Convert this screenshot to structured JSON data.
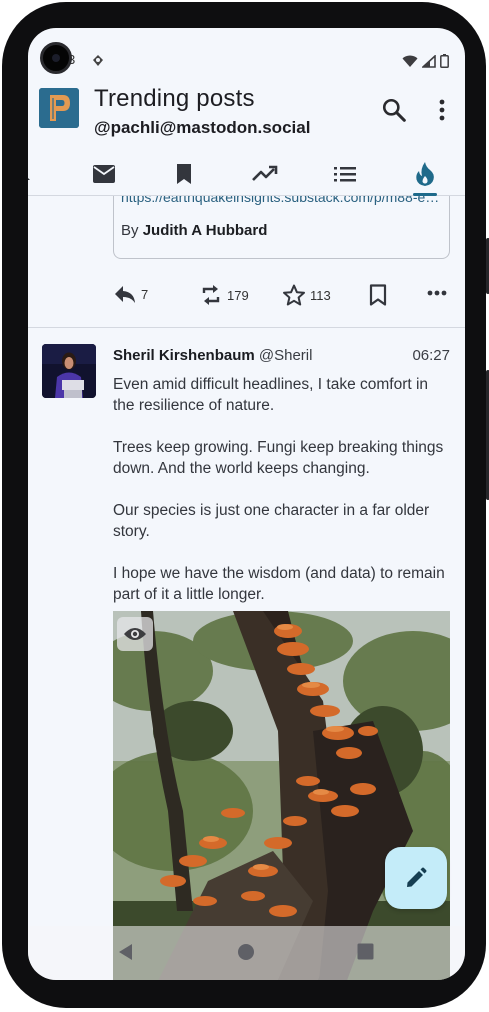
{
  "status_bar": {
    "time_fragment": "3",
    "icons": [
      "notification-icon",
      "wifi-icon",
      "signal-icon",
      "battery-icon"
    ]
  },
  "app_bar": {
    "title": "Trending posts",
    "account": "@pachli@mastodon.social",
    "logo_letter": "P",
    "actions": [
      "search-icon",
      "overflow-menu-icon"
    ]
  },
  "tabs": [
    {
      "name": "tab-notifications",
      "icon": "bell-icon",
      "selected": false
    },
    {
      "name": "tab-messages",
      "icon": "mail-icon",
      "selected": false
    },
    {
      "name": "tab-bookmarks",
      "icon": "bookmark-icon",
      "selected": false
    },
    {
      "name": "tab-trending",
      "icon": "trending-icon",
      "selected": false
    },
    {
      "name": "tab-lists",
      "icon": "list-icon",
      "selected": false
    },
    {
      "name": "tab-trending-posts",
      "icon": "flame-icon",
      "selected": true
    }
  ],
  "previous_post": {
    "link_url": "https://earthquakeinsights.substack.com/p/m88-ea...",
    "link_author_prefix": "By",
    "link_author": "Judith A Hubbard",
    "actions": {
      "replies": "7",
      "boosts": "179",
      "favourites": "113"
    }
  },
  "post": {
    "display_name": "Sheril Kirshenbaum",
    "handle": "@Sheril",
    "time": "06:27",
    "paragraphs": [
      "Even amid difficult headlines, I take comfort in the resilience of nature.",
      "Trees keep growing. Fungi keep breaking things down. And the world keeps changing.",
      "Our species is just one character in a far older story.",
      "I hope we have the wisdom (and data) to remain part of it a little longer."
    ]
  },
  "fab": {
    "icon": "pencil-icon"
  },
  "nav_bar": {
    "icons": [
      "back-icon",
      "home-icon",
      "recents-icon"
    ]
  },
  "colors": {
    "accent": "#1f6a8a",
    "background": "#f4f7fc",
    "fab": "#c4ecf9",
    "link": "#2a6180"
  }
}
